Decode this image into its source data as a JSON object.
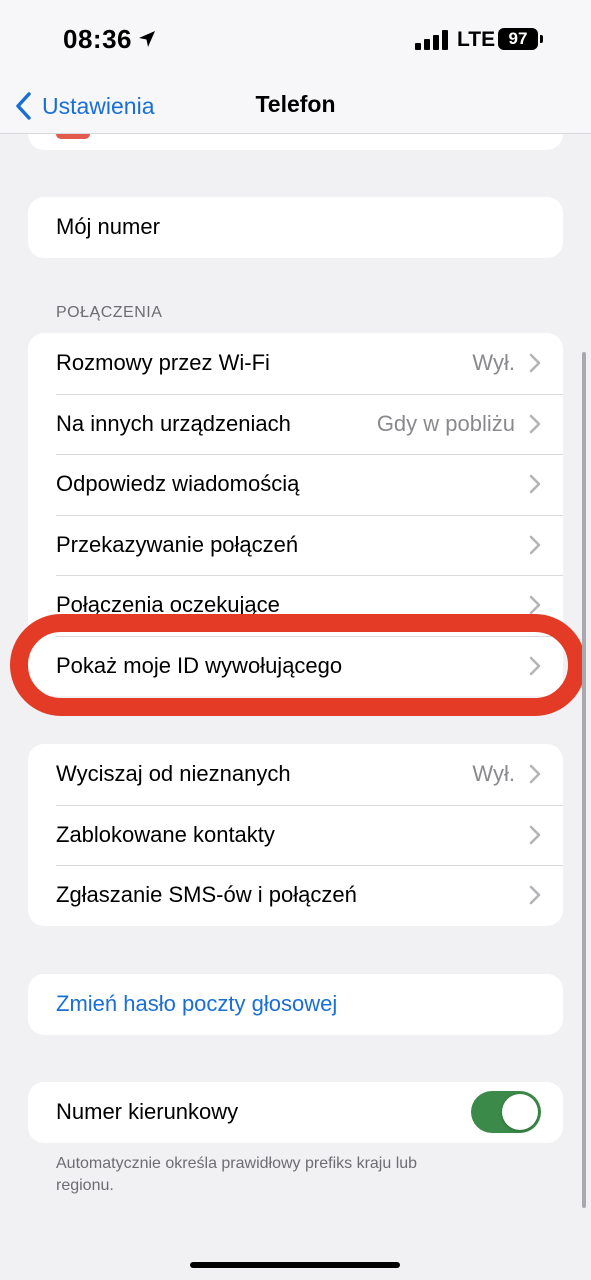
{
  "status_bar": {
    "time": "08:36",
    "network": "LTE",
    "battery": "97"
  },
  "nav": {
    "back_label": "Ustawienia",
    "title": "Telefon"
  },
  "my_number": {
    "label": "Mój numer"
  },
  "calls_section": {
    "header": "POŁĄCZENIA",
    "rows": [
      {
        "label": "Rozmowy przez Wi-Fi",
        "value": "Wył."
      },
      {
        "label": "Na innych urządzeniach",
        "value": "Gdy w pobliżu"
      },
      {
        "label": "Odpowiedz wiadomością",
        "value": ""
      },
      {
        "label": "Przekazywanie połączeń",
        "value": ""
      },
      {
        "label": "Połączenia oczekujące",
        "value": ""
      },
      {
        "label": "Pokaż moje ID wywołującego",
        "value": ""
      }
    ]
  },
  "blocking_section": {
    "rows": [
      {
        "label": "Wyciszaj od nieznanych",
        "value": "Wył."
      },
      {
        "label": "Zablokowane kontakty",
        "value": ""
      },
      {
        "label": "Zgłaszanie SMS-ów i połączeń",
        "value": ""
      }
    ]
  },
  "voicemail": {
    "label": "Zmień hasło poczty głosowej"
  },
  "dial_assist": {
    "label": "Numer kierunkowy",
    "enabled": true,
    "footer": "Automatycznie określa prawidłowy prefiks kraju lub regionu."
  },
  "colors": {
    "accent": "#1a6fd4",
    "toggle_on": "#3b8a4a",
    "highlight": "#e33b26"
  }
}
